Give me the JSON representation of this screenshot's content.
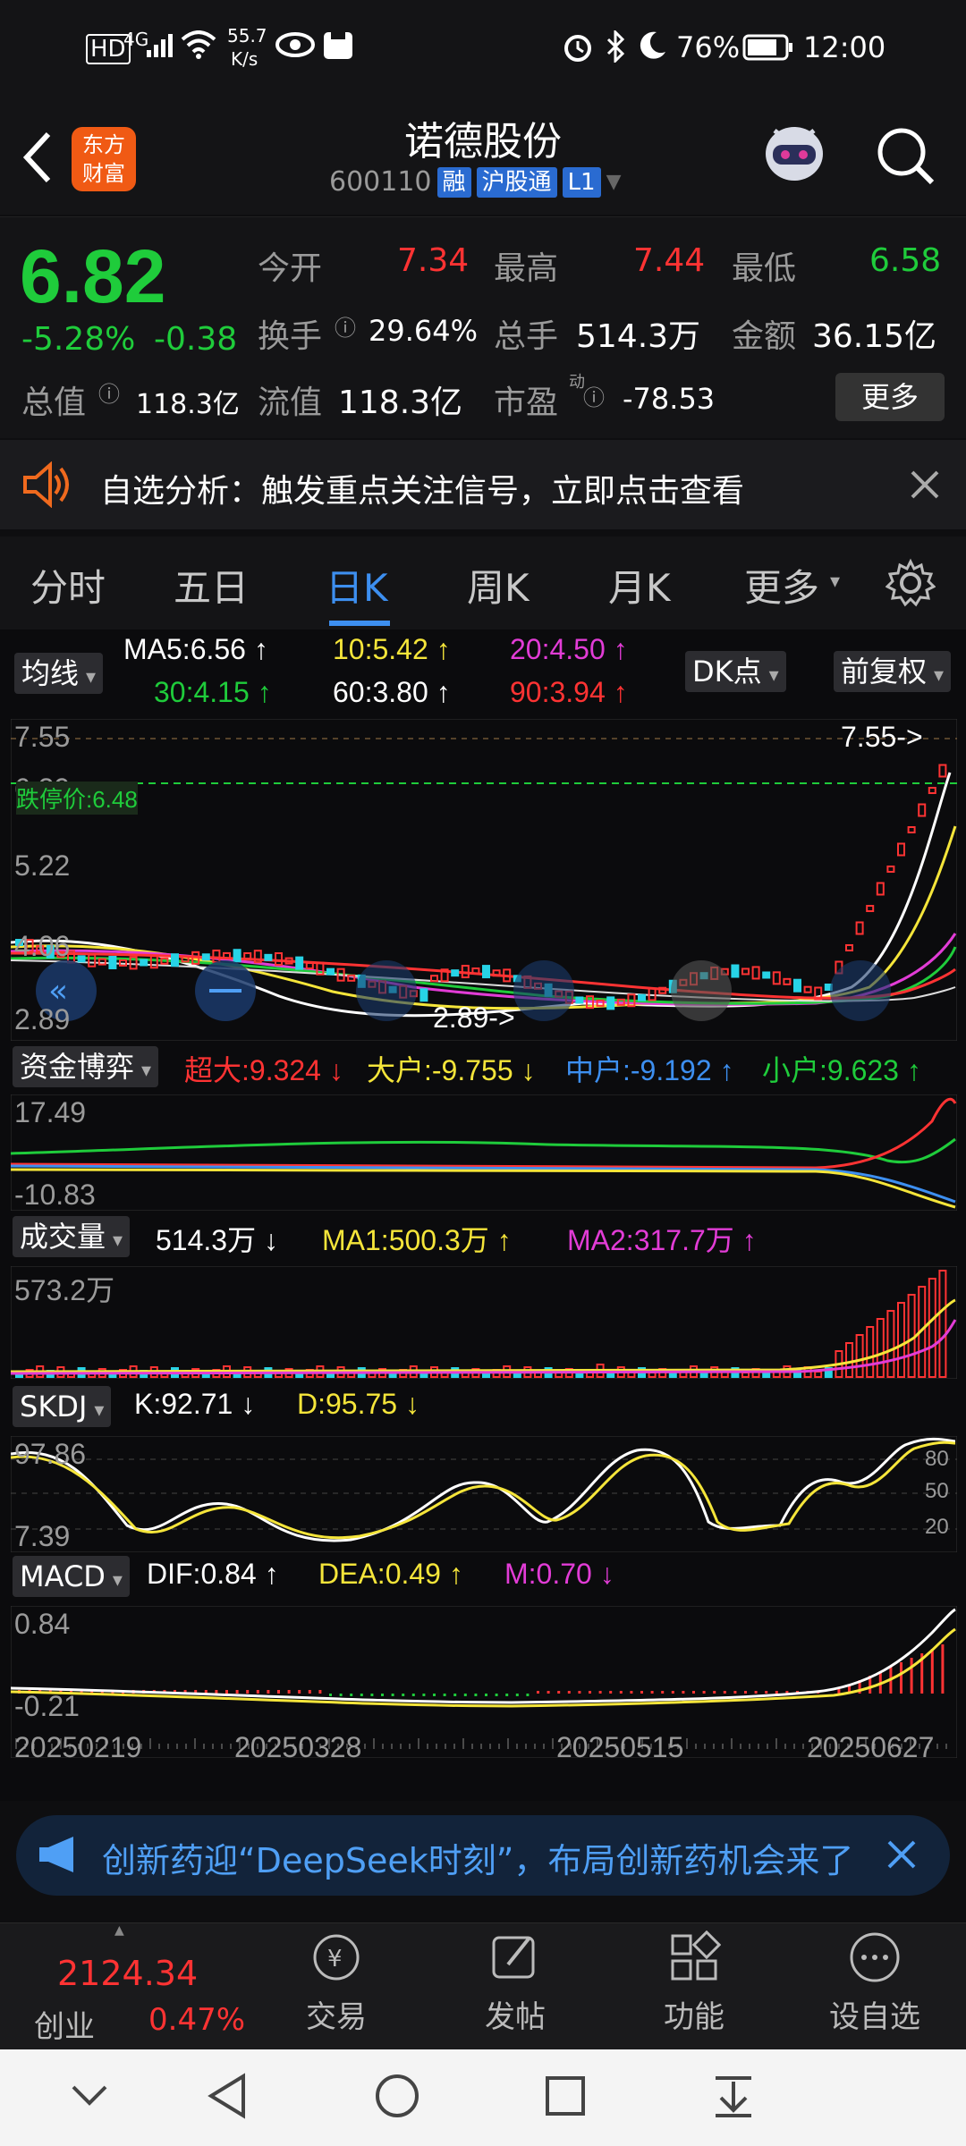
{
  "status": {
    "hd": "HD",
    "net": "4G",
    "speed": "55.7",
    "speed_unit": "K/s",
    "battery": "76%",
    "time": "12:00"
  },
  "header": {
    "logo_line1": "东方",
    "logo_line2": "财富",
    "title": "诺德股份",
    "code": "600110",
    "tags": [
      "融",
      "沪股通",
      "L1"
    ]
  },
  "quote": {
    "price": "6.82",
    "change_pct": "-5.28%",
    "change": "-0.38",
    "open_label": "今开",
    "open": "7.34",
    "high_label": "最高",
    "high": "7.44",
    "low_label": "最低",
    "low": "6.58",
    "turnover_label": "换手",
    "turnover": "29.64%",
    "volume_label": "总手",
    "volume": "514.3万",
    "amount_label": "金额",
    "amount": "36.15亿",
    "mcap_label": "总值",
    "mcap": "118.3亿",
    "float_label": "流值",
    "float": "118.3亿",
    "pe_label": "市盈",
    "pe_sup": "动",
    "pe": "-78.53",
    "more": "更多"
  },
  "notice": {
    "text": "自选分析：触发重点关注信号，立即点击查看"
  },
  "tabs": [
    "分时",
    "五日",
    "日K",
    "周K",
    "月K",
    "更多"
  ],
  "active_tab": "日K",
  "kline": {
    "ma_btn": "均线",
    "dk_btn": "DK点",
    "fq_btn": "前复权",
    "ma5": "MA5:6.56 ↑",
    "ma10": "10:5.42 ↑",
    "ma20": "20:4.50 ↑",
    "ma30": "30:4.15 ↑",
    "ma60": "60:3.80 ↑",
    "ma90": "90:3.94 ↑",
    "y_labels": [
      "7.55",
      "6.39",
      "5.22",
      "4.06",
      "2.89"
    ],
    "limit_down": "跌停价:6.48",
    "max_mark": "7.55->",
    "min_mark": "2.89->"
  },
  "fund": {
    "btn": "资金博弈",
    "super": "超大:9.324 ↓",
    "large": "大户:-9.755 ↓",
    "mid": "中户:-9.192 ↑",
    "small": "小户:9.623 ↑",
    "y_top": "17.49",
    "y_bot": "-10.83"
  },
  "vol": {
    "btn": "成交量",
    "val": "514.3万 ↓",
    "ma1": "MA1:500.3万 ↑",
    "ma2": "MA2:317.7万 ↑",
    "y_top": "573.2万"
  },
  "skdj": {
    "btn": "SKDJ",
    "k": "K:92.71 ↓",
    "d": "D:95.75 ↓",
    "y_top": "97.86",
    "y_bot": "7.39",
    "levels": [
      "80",
      "50",
      "20"
    ]
  },
  "macd": {
    "btn": "MACD",
    "dif": "DIF:0.84 ↑",
    "dea": "DEA:0.49 ↑",
    "m": "M:0.70 ↓",
    "y_top": "0.84",
    "y_bot": "-0.21"
  },
  "dates": [
    "20250219",
    "20250328",
    "20250515",
    "20250627"
  ],
  "ad": {
    "text": "创新药迎“DeepSeek时刻”，布局创新药机会来了"
  },
  "bottom": {
    "index_value": "2124.34",
    "index_name": "创业",
    "index_pct": "0.47%",
    "items": [
      "交易",
      "发帖",
      "功能",
      "设自选"
    ]
  }
}
